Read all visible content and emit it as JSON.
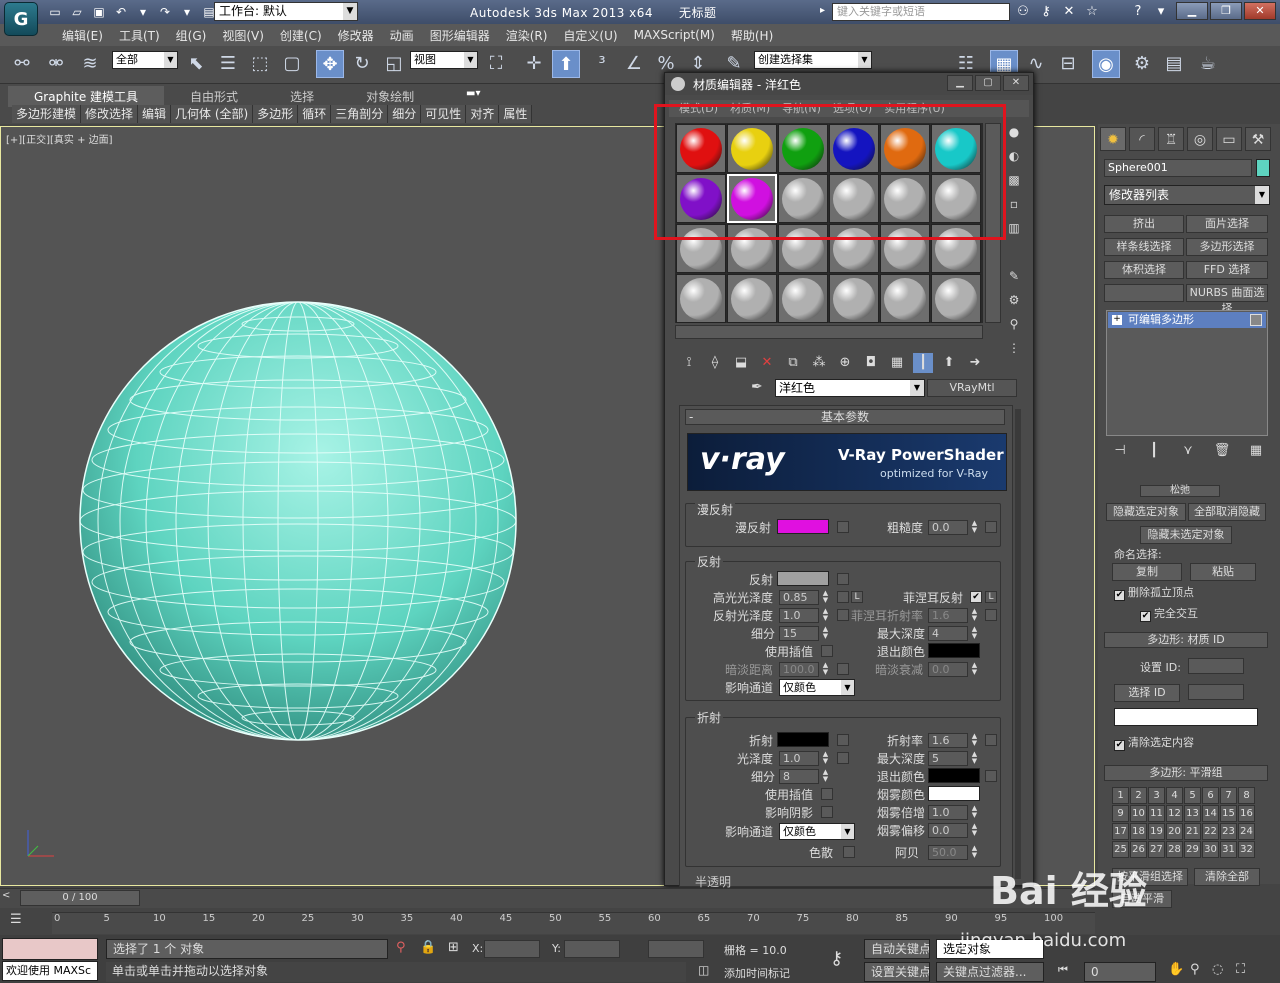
{
  "titlebar": {
    "workspace": "工作台: 默认",
    "app_title": "Autodesk 3ds Max  2013 x64",
    "doc_title": "无标题",
    "search_placeholder": "键入关键字或短语"
  },
  "menu": [
    "编辑(E)",
    "工具(T)",
    "组(G)",
    "视图(V)",
    "创建(C)",
    "修改器",
    "动画",
    "图形编辑器",
    "渲染(R)",
    "自定义(U)",
    "MAXScript(M)",
    "帮助(H)"
  ],
  "toolbar": {
    "filter": "全部",
    "refcoord": "视图",
    "named_sel": "创建选择集"
  },
  "ribbon": {
    "tabs": [
      "Graphite 建模工具",
      "自由形式",
      "选择",
      "对象绘制"
    ],
    "tools": [
      "多边形建模",
      "修改选择",
      "编辑",
      "几何体 (全部)",
      "多边形",
      "循环",
      "三角剖分",
      "细分",
      "可见性",
      "对齐",
      "属性"
    ]
  },
  "viewport": {
    "label": "[+][正交][真实 + 边面]",
    "object_color": "#5ed4c0"
  },
  "matedit": {
    "title": "材质编辑器 - 洋红色",
    "menu": [
      "模式(D)",
      "材质(M)",
      "导航(N)",
      "选项(O)",
      "实用程序(U)"
    ],
    "slots": [
      "#e01010",
      "#e8d010",
      "#10a010",
      "#1414c0",
      "#e06a10",
      "#18c8c8",
      "#8010c8",
      "#d010e0",
      "#b0b0b0",
      "#b0b0b0",
      "#b0b0b0",
      "#b0b0b0",
      "#b0b0b0",
      "#b0b0b0",
      "#b0b0b0",
      "#b0b0b0",
      "#b0b0b0",
      "#b0b0b0",
      "#b0b0b0",
      "#b0b0b0",
      "#b0b0b0",
      "#b0b0b0",
      "#b0b0b0",
      "#b0b0b0"
    ],
    "material_name": "洋红色",
    "material_type": "VRayMtl",
    "rollout": "基本参数",
    "banner_logo": "v·ray",
    "banner_title": "V-Ray PowerShader",
    "banner_sub": "optimized for V-Ray",
    "diffuse": {
      "group": "漫反射",
      "label": "漫反射",
      "color": "#e010e0",
      "rough_label": "粗糙度",
      "rough": "0.0"
    },
    "reflect": {
      "group": "反射",
      "label": "反射",
      "color": "#a0a0a0",
      "hilight_label": "高光光泽度",
      "hilight": "0.85",
      "gloss_label": "反射光泽度",
      "gloss": "1.0",
      "subdiv_label": "细分",
      "subdiv": "15",
      "interp_label": "使用插值",
      "dimdist_label": "暗淡距离",
      "dimdist": "100.0",
      "affect_label": "影响通道",
      "affect": "仅颜色",
      "fresnel_label": "菲涅耳反射",
      "fresnel_ior_label": "菲涅耳折射率",
      "fresnel_ior": "1.6",
      "maxdepth_label": "最大深度",
      "maxdepth": "4",
      "exit_label": "退出颜色",
      "dimfall_label": "暗淡衰减",
      "dimfall": "0.0"
    },
    "refract": {
      "group": "折射",
      "label": "折射",
      "gloss_label": "光泽度",
      "gloss": "1.0",
      "subdiv_label": "细分",
      "subdiv": "8",
      "interp_label": "使用插值",
      "shadow_label": "影响阴影",
      "affect_label": "影响通道",
      "affect": "仅颜色",
      "ior_label": "折射率",
      "ior": "1.6",
      "maxdepth_label": "最大深度",
      "maxdepth": "5",
      "exit_label": "退出颜色",
      "fogc_label": "烟雾颜色",
      "fogm_label": "烟雾倍增",
      "fogm": "1.0",
      "fogb_label": "烟雾偏移",
      "fogb": "0.0",
      "disp_label": "色散",
      "abbe_label": "阿贝",
      "abbe": "50.0"
    },
    "next_group": "半透明"
  },
  "cmdpanel": {
    "obj_name": "Sphere001",
    "modlist": "修改器列表",
    "buttons": [
      "挤出",
      "面片选择",
      "样条线选择",
      "多边形选择",
      "体积选择",
      "FFD 选择",
      "",
      "NURBS 曲面选择"
    ],
    "stack_item": "可编辑多边形",
    "soft": "松弛",
    "hide_sel": "隐藏选定对象",
    "unhide_all": "全部取消隐藏",
    "hide_unsel": "隐藏未选定对象",
    "named_sel": "命名选择:",
    "copy": "复制",
    "paste": "粘贴",
    "del_iso": "删除孤立顶点",
    "full_inter": "完全交互",
    "matid_head": "多边形: 材质 ID",
    "set_id": "设置 ID:",
    "select_id": "选择 ID",
    "clear_sel": "清除选定内容",
    "smooth_head": "多边形: 平滑组",
    "smooth_nums": [
      "1",
      "2",
      "3",
      "4",
      "5",
      "6",
      "7",
      "8",
      "9",
      "10",
      "11",
      "12",
      "13",
      "14",
      "15",
      "16",
      "17",
      "18",
      "19",
      "20",
      "21",
      "22",
      "23",
      "24",
      "25",
      "26",
      "27",
      "28",
      "29",
      "30",
      "31",
      "32"
    ],
    "sel_by_smooth": "按平滑组选择",
    "clear_all": "清除全部",
    "auto": "自动平滑"
  },
  "timeline": {
    "frame": "0 / 100",
    "ticks": [
      "0",
      "5",
      "10",
      "15",
      "20",
      "25",
      "30",
      "35",
      "40",
      "45",
      "50",
      "55",
      "60",
      "65",
      "70",
      "75",
      "80",
      "85",
      "90",
      "95",
      "100"
    ]
  },
  "status": {
    "welcome": "欢迎使用 MAXSc",
    "selected": "选择了 1 个 对象",
    "hint": "单击或单击并拖动以选择对象",
    "x": "X:",
    "y": "Y:",
    "grid": "栅格 = 10.0",
    "add_time_tag": "添加时间标记",
    "autokey": "自动关键点",
    "sel_obj": "选定对象",
    "setkey": "设置关键点",
    "keyfilter": "关键点过滤器...",
    "frame": "0"
  },
  "watermark": {
    "brand": "Bai 经验",
    "url": "jingyan.baidu.com"
  }
}
